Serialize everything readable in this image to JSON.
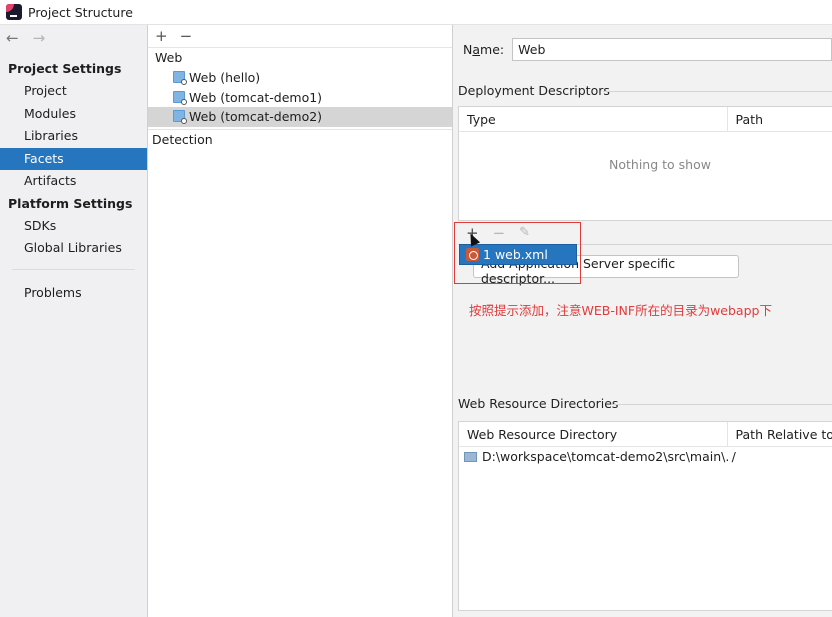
{
  "window": {
    "title": "Project Structure"
  },
  "nav": {
    "back": "←",
    "forward": "→"
  },
  "sidebar": {
    "project_settings_title": "Project Settings",
    "project_settings": [
      {
        "label": "Project",
        "selected": false
      },
      {
        "label": "Modules",
        "selected": false
      },
      {
        "label": "Libraries",
        "selected": false
      },
      {
        "label": "Facets",
        "selected": true
      },
      {
        "label": "Artifacts",
        "selected": false
      }
    ],
    "platform_settings_title": "Platform Settings",
    "platform_settings": [
      {
        "label": "SDKs"
      },
      {
        "label": "Global Libraries"
      }
    ],
    "problems": "Problems"
  },
  "facets": {
    "toolbar": {
      "add": "+",
      "remove": "−"
    },
    "group": "Web",
    "items": [
      {
        "label": "Web (hello)",
        "selected": false
      },
      {
        "label": "Web (tomcat-demo1)",
        "selected": false
      },
      {
        "label": "Web (tomcat-demo2)",
        "selected": true
      }
    ],
    "detection": "Detection"
  },
  "detail": {
    "name_label_prefix": "N",
    "name_label_underlined": "a",
    "name_label_suffix": "me:",
    "name_value": "Web",
    "deployment_descriptors": {
      "title": "Deployment Descriptors",
      "columns": [
        "Type",
        "Path"
      ],
      "empty_text": "Nothing to show",
      "toolbar": {
        "add": "+",
        "remove": "−",
        "edit": "✎"
      },
      "add_button": "Add Application Server specific descriptor..."
    },
    "popup": {
      "index": "1",
      "item": "web.xml"
    },
    "annotation": "按照提示添加，注意WEB-INF所在的目录为webapp下",
    "web_resources": {
      "title": "Web Resource Directories",
      "columns": [
        "Web Resource Directory",
        "Path Relative to D"
      ],
      "rows": [
        {
          "directory": "D:\\workspace\\tomcat-demo2\\src\\main\\...",
          "relative": "/"
        }
      ]
    }
  },
  "colors": {
    "selection": "#2675bf",
    "annotation": "#e03b3b",
    "tree_selected": "#d5d5d5"
  }
}
